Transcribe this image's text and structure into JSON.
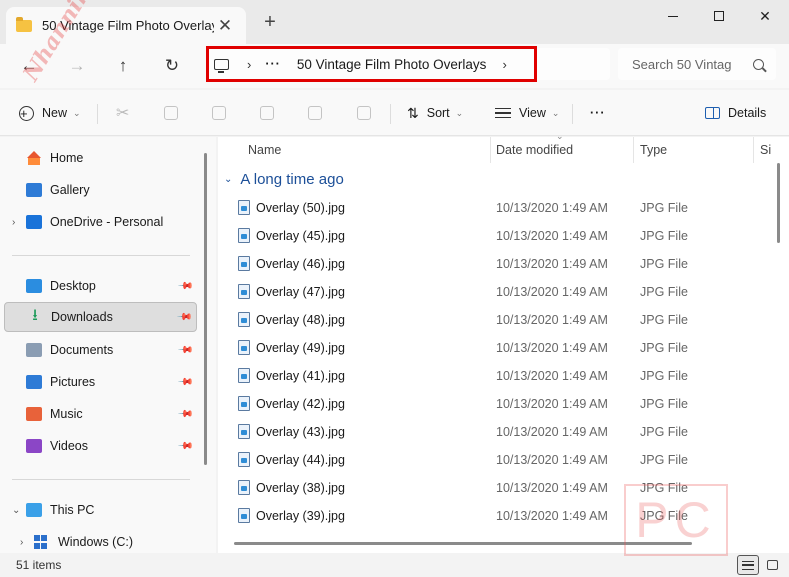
{
  "window": {
    "tab_title": "50 Vintage Film Photo Overlays",
    "new_tab": "+"
  },
  "address": {
    "more": "···",
    "current": "50 Vintage Film Photo Overlays",
    "search_placeholder": "Search 50 Vintag"
  },
  "toolbar": {
    "new_label": "New",
    "sort_label": "Sort",
    "view_label": "View",
    "more_label": "···",
    "details_label": "Details"
  },
  "nav": {
    "home": "Home",
    "gallery": "Gallery",
    "onedrive": "OneDrive - Personal",
    "desktop": "Desktop",
    "downloads": "Downloads",
    "documents": "Documents",
    "pictures": "Pictures",
    "music": "Music",
    "videos": "Videos",
    "this_pc": "This PC",
    "windows_c": "Windows (C:)"
  },
  "columns": {
    "name": "Name",
    "date": "Date modified",
    "type": "Type",
    "size": "Si"
  },
  "group": "A long time ago",
  "files": [
    {
      "name": "Overlay (50).jpg",
      "date": "10/13/2020 1:49 AM",
      "type": "JPG File"
    },
    {
      "name": "Overlay (45).jpg",
      "date": "10/13/2020 1:49 AM",
      "type": "JPG File"
    },
    {
      "name": "Overlay (46).jpg",
      "date": "10/13/2020 1:49 AM",
      "type": "JPG File"
    },
    {
      "name": "Overlay (47).jpg",
      "date": "10/13/2020 1:49 AM",
      "type": "JPG File"
    },
    {
      "name": "Overlay (48).jpg",
      "date": "10/13/2020 1:49 AM",
      "type": "JPG File"
    },
    {
      "name": "Overlay (49).jpg",
      "date": "10/13/2020 1:49 AM",
      "type": "JPG File"
    },
    {
      "name": "Overlay (41).jpg",
      "date": "10/13/2020 1:49 AM",
      "type": "JPG File"
    },
    {
      "name": "Overlay (42).jpg",
      "date": "10/13/2020 1:49 AM",
      "type": "JPG File"
    },
    {
      "name": "Overlay (43).jpg",
      "date": "10/13/2020 1:49 AM",
      "type": "JPG File"
    },
    {
      "name": "Overlay (44).jpg",
      "date": "10/13/2020 1:49 AM",
      "type": "JPG File"
    },
    {
      "name": "Overlay (38).jpg",
      "date": "10/13/2020 1:49 AM",
      "type": "JPG File"
    },
    {
      "name": "Overlay (39).jpg",
      "date": "10/13/2020 1:49 AM",
      "type": "JPG File"
    }
  ],
  "status": {
    "item_count": "51 items"
  },
  "watermark": {
    "left_text": "Nhanning PC",
    "right_text": "PC"
  }
}
